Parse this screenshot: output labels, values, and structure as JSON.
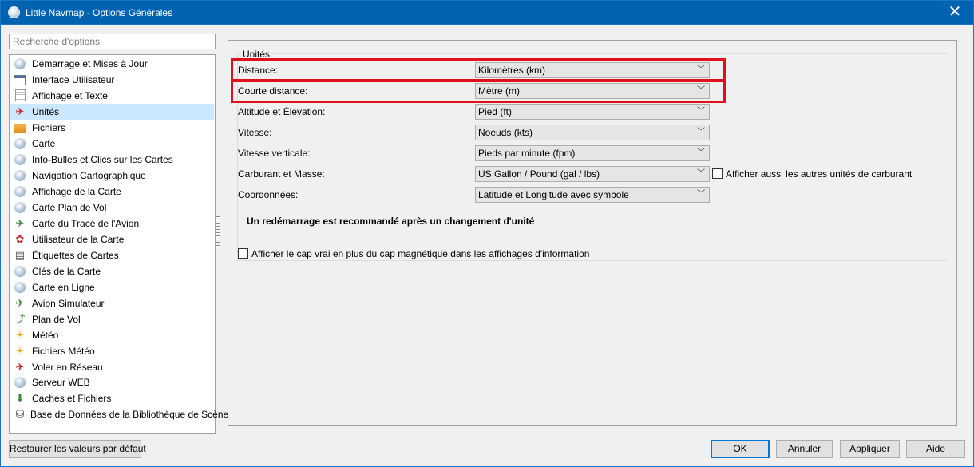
{
  "window": {
    "title": "Little Navmap - Options Générales"
  },
  "search": {
    "placeholder": "Recherche d'options"
  },
  "sidebar": {
    "items": [
      {
        "label": "Démarrage et Mises à Jour",
        "icon": "globe-icon"
      },
      {
        "label": "Interface Utilisateur",
        "icon": "window-icon"
      },
      {
        "label": "Affichage et Texte",
        "icon": "document-icon"
      },
      {
        "label": "Unités",
        "icon": "units-icon",
        "selected": true
      },
      {
        "label": "Fichiers",
        "icon": "folder-icon"
      },
      {
        "label": "Carte",
        "icon": "globe-icon"
      },
      {
        "label": "Info-Bulles et Clics sur les Cartes",
        "icon": "globe-info-icon"
      },
      {
        "label": "Navigation Cartographique",
        "icon": "globe-navigation-icon"
      },
      {
        "label": "Affichage de la Carte",
        "icon": "globe-display-icon"
      },
      {
        "label": "Carte Plan de Vol",
        "icon": "globe-flightplan-icon"
      },
      {
        "label": "Carte du Tracé de l'Avion",
        "icon": "aircraft-trail-icon"
      },
      {
        "label": "Utilisateur de la Carte",
        "icon": "user-map-icon"
      },
      {
        "label": "Étiquettes de Cartes",
        "icon": "labels-icon"
      },
      {
        "label": "Clés de la Carte",
        "icon": "map-keys-icon"
      },
      {
        "label": "Carte en Ligne",
        "icon": "online-map-icon"
      },
      {
        "label": "Avion Simulateur",
        "icon": "aircraft-icon"
      },
      {
        "label": "Plan de Vol",
        "icon": "flightplan-icon"
      },
      {
        "label": "Météo",
        "icon": "weather-icon"
      },
      {
        "label": "Fichiers Météo",
        "icon": "weather-files-icon"
      },
      {
        "label": "Voler en Réseau",
        "icon": "network-aircraft-icon"
      },
      {
        "label": "Serveur WEB",
        "icon": "web-server-icon"
      },
      {
        "label": "Caches et Fichiers",
        "icon": "cache-download-icon"
      },
      {
        "label": "Base de Données de la Bibliothèque de Scènes",
        "icon": "database-icon"
      }
    ]
  },
  "units": {
    "group_title": "Unités",
    "rows": [
      {
        "label": "Distance:",
        "value": "Kilomètres (km)"
      },
      {
        "label": "Courte distance:",
        "value": "Mètre (m)"
      },
      {
        "label": "Altitude et Élévation:",
        "value": "Pied (ft)"
      },
      {
        "label": "Vitesse:",
        "value": "Noeuds (kts)"
      },
      {
        "label": "Vitesse verticale:",
        "value": "Pieds par minute (fpm)"
      },
      {
        "label": "Carburant et Masse:",
        "value": "US Gallon / Pound (gal / lbs)"
      },
      {
        "label": "Coordonnées:",
        "value": "Latitude et Longitude avec symbole"
      }
    ],
    "fuel_checkbox_label": "Afficher aussi les autres unités de carburant",
    "fuel_checkbox_checked": false,
    "restart_note": "Un redémarrage est recommandé après un changement d'unité",
    "true_course_checkbox_label": "Afficher le cap vrai en plus du cap magnétique dans les affichages d'information",
    "true_course_checkbox_checked": false
  },
  "buttons": {
    "restore_defaults": "Restaurer les valeurs par défaut",
    "ok": "OK",
    "cancel": "Annuler",
    "apply": "Appliquer",
    "help": "Aide"
  },
  "colors": {
    "titlebar": "#0063b1",
    "selection": "#cce8ff",
    "highlight_box": "#e0101a",
    "default_button_border": "#0078d7"
  }
}
